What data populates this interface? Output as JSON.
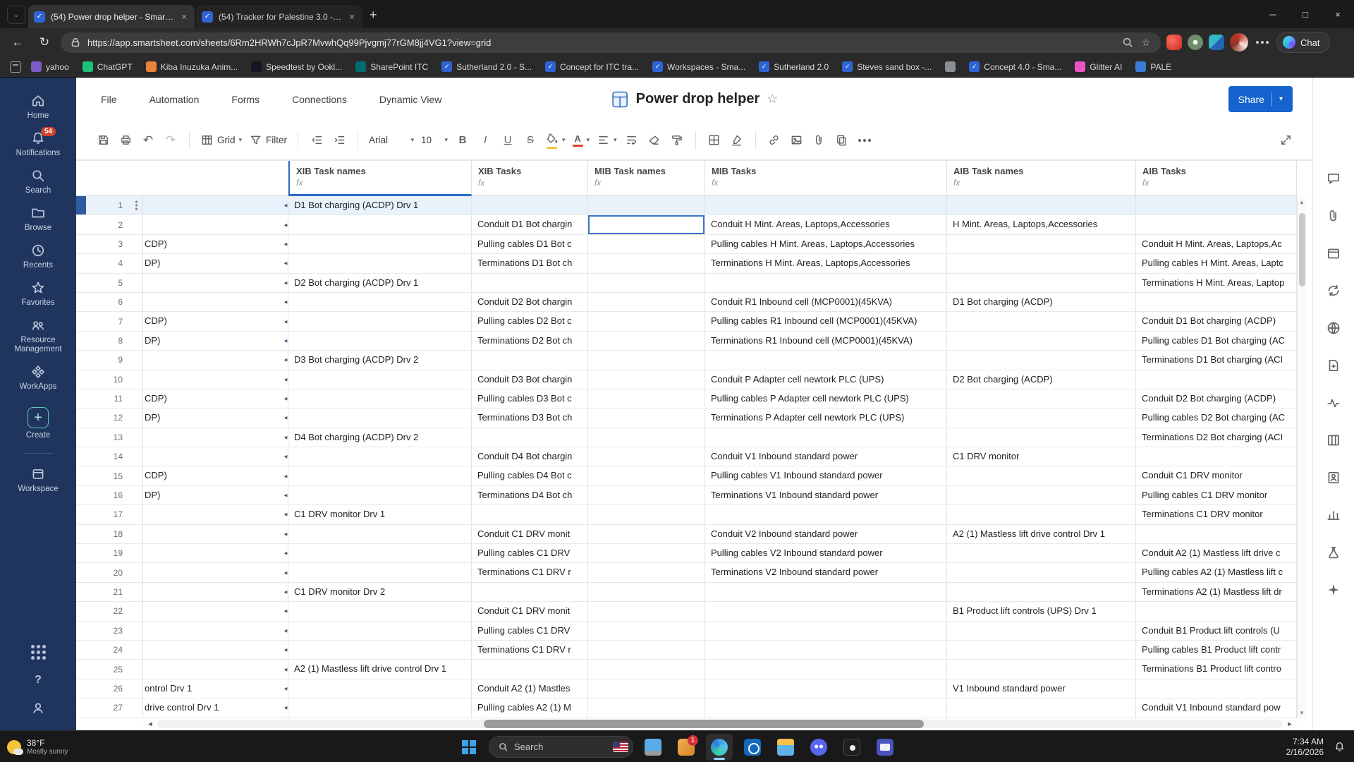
{
  "browser": {
    "tabs": [
      {
        "title": "(54) Power drop helper - Smartshe...",
        "active": true
      },
      {
        "title": "(54) Tracker for Palestine 3.0 - Sma...",
        "active": false
      }
    ],
    "url": "https://app.smartsheet.com/sheets/6Rm2HRWh7cJpR7MvwhQq99Pjvgmj77rGM8jj4VG1?view=grid",
    "chat_label": "Chat",
    "bookmarks": [
      {
        "label": "yahoo",
        "color": "#7b5cc6",
        "smartsheet": false
      },
      {
        "label": "ChatGPT",
        "color": "#19c37d",
        "smartsheet": false
      },
      {
        "label": "Kiba Inuzuka Anim...",
        "color": "#e8833a",
        "smartsheet": false
      },
      {
        "label": "Speedtest by Ookl...",
        "color": "#141526",
        "smartsheet": false
      },
      {
        "label": "SharePoint ITC",
        "color": "#036c70",
        "smartsheet": false
      },
      {
        "label": "Sutherland 2.0 - S...",
        "color": "#2f64d6",
        "smartsheet": true
      },
      {
        "label": "Concept for ITC tra...",
        "color": "#2f64d6",
        "smartsheet": true
      },
      {
        "label": "Workspaces - Sma...",
        "color": "#2f64d6",
        "smartsheet": true
      },
      {
        "label": "Sutherland 2.0",
        "color": "#2f64d6",
        "smartsheet": true
      },
      {
        "label": "Steves sand box -...",
        "color": "#2f64d6",
        "smartsheet": true
      },
      {
        "label": "",
        "color": "#8a8f98",
        "smartsheet": false
      },
      {
        "label": "Concept 4.0 - Sma...",
        "color": "#2f64d6",
        "smartsheet": true
      },
      {
        "label": "Glitter AI",
        "color": "#e954c4",
        "smartsheet": false
      },
      {
        "label": "PALE",
        "color": "#3a7bd5",
        "smartsheet": false
      }
    ]
  },
  "sidebar": {
    "items": [
      {
        "label": "Home",
        "icon": "home-icon"
      },
      {
        "label": "Notifications",
        "icon": "bell-icon",
        "badge": "54"
      },
      {
        "label": "Search",
        "icon": "search-icon"
      },
      {
        "label": "Browse",
        "icon": "folder-icon"
      },
      {
        "label": "Recents",
        "icon": "clock-icon"
      },
      {
        "label": "Favorites",
        "icon": "star-icon"
      },
      {
        "label": "Resource Management",
        "icon": "people-icon"
      },
      {
        "label": "WorkApps",
        "icon": "workapps-icon"
      },
      {
        "label": "Create",
        "icon": "plus-icon"
      },
      {
        "label": "Workspace",
        "icon": "workspace-icon"
      }
    ]
  },
  "app": {
    "menus": [
      "File",
      "Automation",
      "Forms",
      "Connections",
      "Dynamic View"
    ],
    "title": "Power drop helper",
    "share_label": "Share",
    "toolbar": {
      "view": "Grid",
      "filter": "Filter",
      "font": "Arial",
      "size": "10"
    }
  },
  "right_rail": {
    "icons": [
      "comments-icon",
      "attachments-icon",
      "proofs-icon",
      "update-requests-icon",
      "publish-icon",
      "summary-icon",
      "activity-log-icon",
      "columns-icon",
      "contacts-icon",
      "insights-icon",
      "experiments-icon",
      "ai-assistant-icon"
    ]
  },
  "grid": {
    "fx_label": "fx",
    "columns": [
      "XIB Task names",
      "XIB Tasks",
      "MIB Task names",
      "MIB Tasks",
      "AIB Task names",
      "AIB Tasks"
    ],
    "selected_row": 1,
    "selected_cell": {
      "row": 2,
      "column": "MIB Task names"
    },
    "rows": [
      [
        "",
        "D1 Bot charging (ACDP) Drv 1",
        "",
        "",
        "",
        "",
        ""
      ],
      [
        "",
        "",
        "Conduit D1 Bot chargin",
        "",
        "Conduit H Mint. Areas, Laptops,Accessories",
        "H Mint. Areas, Laptops,Accessories",
        ""
      ],
      [
        "CDP)",
        "",
        "Pulling cables D1 Bot c",
        "",
        "Pulling cables H Mint. Areas, Laptops,Accessories",
        "",
        "Conduit H Mint. Areas, Laptops,Ac"
      ],
      [
        "DP)",
        "",
        "Terminations D1 Bot ch",
        "",
        "Terminations H Mint. Areas, Laptops,Accessories",
        "",
        "Pulling cables H Mint. Areas, Laptc"
      ],
      [
        "",
        "D2 Bot charging (ACDP) Drv 1",
        "",
        "",
        "",
        "",
        "Terminations H Mint. Areas, Laptop"
      ],
      [
        "",
        "",
        "Conduit D2 Bot chargin",
        "",
        "Conduit R1 Inbound cell (MCP0001)(45KVA)",
        "D1 Bot charging (ACDP)",
        ""
      ],
      [
        "CDP)",
        "",
        "Pulling cables D2 Bot c",
        "",
        "Pulling cables R1 Inbound cell (MCP0001)(45KVA)",
        "",
        "Conduit D1 Bot charging (ACDP)"
      ],
      [
        "DP)",
        "",
        "Terminations D2 Bot ch",
        "",
        "Terminations R1 Inbound cell (MCP0001)(45KVA)",
        "",
        "Pulling cables D1 Bot charging (AC"
      ],
      [
        "",
        "D3 Bot charging (ACDP) Drv 2",
        "",
        "",
        "",
        "",
        "Terminations D1 Bot charging (ACI"
      ],
      [
        "",
        "",
        "Conduit D3 Bot chargin",
        "",
        "Conduit P Adapter cell newtork PLC (UPS)",
        "D2 Bot charging (ACDP)",
        ""
      ],
      [
        "CDP)",
        "",
        "Pulling cables D3 Bot c",
        "",
        "Pulling cables P Adapter cell newtork PLC (UPS)",
        "",
        "Conduit D2 Bot charging (ACDP)"
      ],
      [
        "DP)",
        "",
        "Terminations D3 Bot ch",
        "",
        "Terminations P Adapter cell newtork PLC (UPS)",
        "",
        "Pulling cables D2 Bot charging (AC"
      ],
      [
        "",
        "D4 Bot charging (ACDP) Drv 2",
        "",
        "",
        "",
        "",
        "Terminations D2 Bot charging (ACI"
      ],
      [
        "",
        "",
        "Conduit D4 Bot chargin",
        "",
        "Conduit V1 Inbound standard power",
        "C1 DRV monitor",
        ""
      ],
      [
        "CDP)",
        "",
        "Pulling cables D4 Bot c",
        "",
        "Pulling cables V1 Inbound standard power",
        "",
        "Conduit C1 DRV monitor"
      ],
      [
        "DP)",
        "",
        "Terminations D4 Bot ch",
        "",
        "Terminations V1 Inbound standard power",
        "",
        "Pulling cables C1 DRV monitor"
      ],
      [
        "",
        "C1 DRV monitor Drv 1",
        "",
        "",
        "",
        "",
        "Terminations C1 DRV monitor"
      ],
      [
        "",
        "",
        "Conduit C1 DRV monit",
        "",
        "Conduit V2 Inbound standard power",
        "A2 (1) Mastless lift drive control Drv 1",
        ""
      ],
      [
        "",
        "",
        "Pulling cables C1 DRV",
        "",
        "Pulling cables V2 Inbound standard power",
        "",
        "Conduit A2 (1) Mastless lift drive c"
      ],
      [
        "",
        "",
        "Terminations C1 DRV r",
        "",
        "Terminations V2 Inbound standard power",
        "",
        "Pulling cables A2 (1) Mastless lift c"
      ],
      [
        "",
        "C1 DRV monitor Drv 2",
        "",
        "",
        "",
        "",
        "Terminations A2 (1) Mastless lift dr"
      ],
      [
        "",
        "",
        "Conduit C1 DRV monit",
        "",
        "",
        "B1 Product lift controls (UPS) Drv 1",
        ""
      ],
      [
        "",
        "",
        "Pulling cables C1 DRV",
        "",
        "",
        "",
        "Conduit B1 Product lift controls (U"
      ],
      [
        "",
        "",
        "Terminations C1 DRV r",
        "",
        "",
        "",
        "Pulling cables B1 Product lift contr"
      ],
      [
        "",
        "A2 (1) Mastless lift drive control Drv 1",
        "",
        "",
        "",
        "",
        "Terminations B1 Product lift contro"
      ],
      [
        "ontrol Drv 1",
        "",
        "Conduit A2 (1) Mastles",
        "",
        "",
        "V1 Inbound standard power",
        ""
      ],
      [
        "drive control Drv 1",
        "",
        "Pulling cables A2 (1) M",
        "",
        "",
        "",
        "Conduit V1 Inbound standard pow"
      ]
    ]
  },
  "taskbar": {
    "weather_temp": "38°F",
    "weather_desc": "Mostly sunny",
    "search_placeholder": "Search",
    "time": "7:34 AM",
    "date": "2/16/2026",
    "apps": [
      {
        "name": "desktop-icon"
      },
      {
        "name": "orange-app-icon",
        "badge": "1"
      },
      {
        "name": "edge-icon",
        "active": true
      },
      {
        "name": "outlook-icon"
      },
      {
        "name": "file-explorer-icon"
      },
      {
        "name": "discord-icon"
      },
      {
        "name": "dark-app-icon"
      },
      {
        "name": "teams-icon"
      }
    ]
  }
}
